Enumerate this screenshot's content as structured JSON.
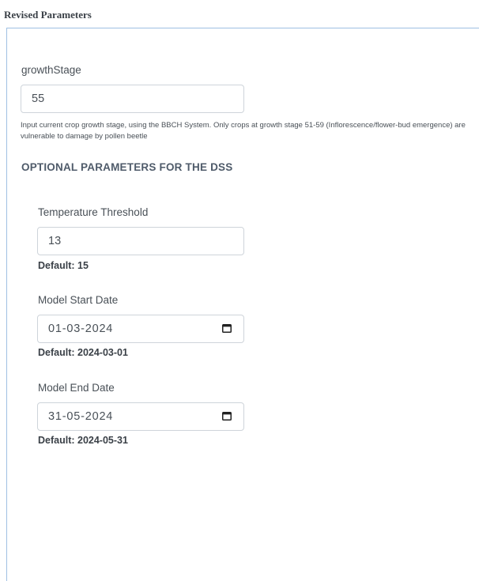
{
  "header": {
    "title": "Revised Parameters"
  },
  "growth_stage": {
    "label": "growthStage",
    "value": "55",
    "help": "Input current crop growth stage, using the BBCH System. Only crops at growth stage 51-59 (Inflorescence/flower-bud emergence) are vulnerable to damage by pollen beetle"
  },
  "optional": {
    "heading": "OPTIONAL PARAMETERS FOR THE DSS",
    "temperature": {
      "label": "Temperature Threshold",
      "value": "13",
      "default": "Default: 15"
    },
    "start_date": {
      "label": "Model Start Date",
      "value": "01-03-2024",
      "default": "Default: 2024-03-01",
      "icon": "calendar-icon"
    },
    "end_date": {
      "label": "Model End Date",
      "value": "31-05-2024",
      "default": "Default: 2024-05-31",
      "icon": "calendar-icon"
    }
  },
  "colors": {
    "panel_border": "#9fc0e3",
    "input_border": "#ced4da",
    "text": "#495057"
  }
}
